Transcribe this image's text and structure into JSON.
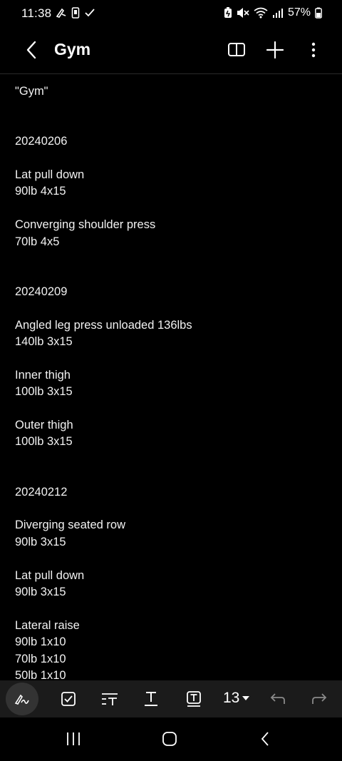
{
  "status_bar": {
    "time": "11:38",
    "battery": "57%"
  },
  "app_bar": {
    "title": "Gym",
    "back_icon": "chevron-left-icon",
    "actions": [
      "reading-mode-icon",
      "plus-icon",
      "more-vertical-icon"
    ]
  },
  "note": {
    "lines": [
      "\"Gym\"",
      "",
      "",
      "20240206",
      "",
      "Lat pull down",
      "90lb 4x15",
      "",
      "Converging shoulder press",
      "70lb 4x5",
      "",
      "",
      "20240209",
      "",
      "Angled leg press unloaded 136lbs",
      "140lb 3x15",
      "",
      "Inner thigh",
      "100lb 3x15",
      "",
      "Outer thigh",
      "100lb 3x15",
      "",
      "",
      "20240212",
      "",
      "Diverging seated row",
      "90lb 3x15",
      "",
      "Lat pull down",
      "90lb 3x15",
      "",
      "Lateral raise",
      "90lb 1x10",
      "70lb 1x10",
      "50lb 1x10"
    ]
  },
  "toolbar": {
    "font_size": "13",
    "tools": [
      "handwriting-icon",
      "checkbox-icon",
      "text-style-icon",
      "underline-text-icon",
      "text-box-icon",
      "undo-icon",
      "redo-icon"
    ]
  },
  "nav_bar": {
    "buttons": [
      "recents-icon",
      "home-icon",
      "back-icon"
    ]
  },
  "colors": {
    "background": "#000000",
    "text": "#f2f2f2",
    "toolbar": "#1b1b1b",
    "disabled": "#8a8a8a"
  }
}
